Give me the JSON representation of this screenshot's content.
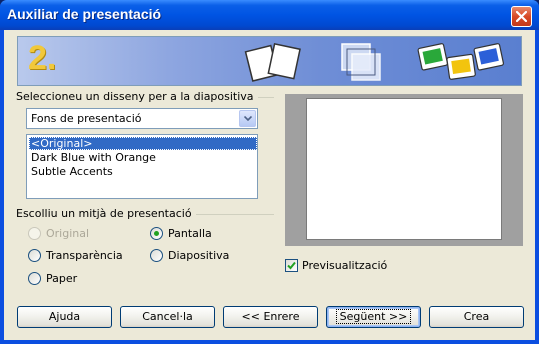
{
  "window": {
    "title": "Auxiliar de presentació"
  },
  "banner": {
    "step_number": "2."
  },
  "design_group": {
    "label": "Seleccioneu un disseny per a la diapositiva",
    "dropdown_value": "Fons de presentació",
    "items": [
      "<Original>",
      "Dark Blue with Orange",
      "Subtle Accents"
    ],
    "selected_index": 0
  },
  "medium_group": {
    "label": "Escolliu un mitjà de presentació",
    "options": [
      {
        "label": "Original",
        "checked": false,
        "disabled": true
      },
      {
        "label": "Pantalla",
        "checked": true,
        "disabled": false
      },
      {
        "label": "Transparència",
        "checked": false,
        "disabled": false
      },
      {
        "label": "Diapositiva",
        "checked": false,
        "disabled": false
      },
      {
        "label": "Paper",
        "checked": false,
        "disabled": false
      }
    ]
  },
  "preview": {
    "checkbox_label": "Previsualització",
    "checked": true
  },
  "buttons": {
    "help": "Ajuda",
    "cancel": "Cancel·la",
    "back": "<< Enrere",
    "next": "Següent >>",
    "create": "Crea"
  }
}
